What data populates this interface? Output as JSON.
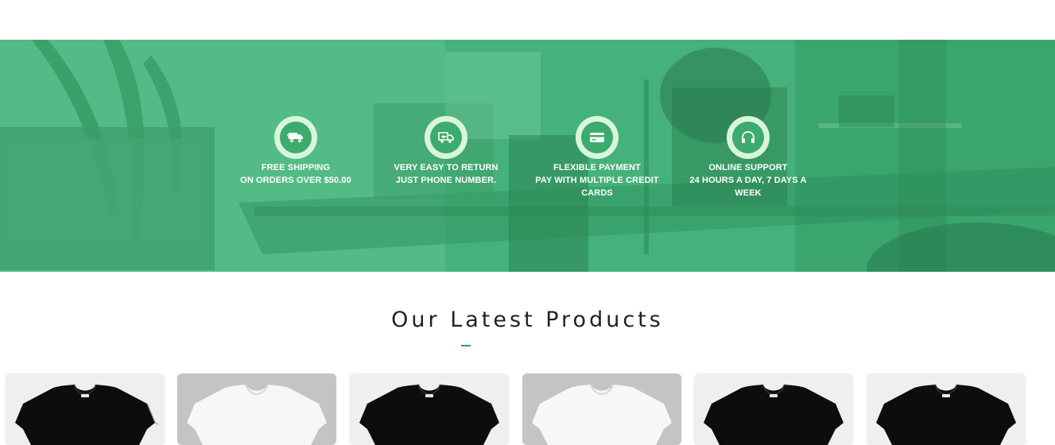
{
  "banner": {
    "overlay_color": "#3faa72",
    "features": [
      {
        "icon": "truck-icon",
        "title": "FREE SHIPPING",
        "subtitle": "ON ORDERS OVER $50.00"
      },
      {
        "icon": "return-truck-icon",
        "title": "VERY EASY TO RETURN",
        "subtitle": "JUST PHONE NUMBER."
      },
      {
        "icon": "credit-card-icon",
        "title": "FLEXIBLE PAYMENT",
        "subtitle": "PAY WITH MULTIPLE CREDIT CARDS"
      },
      {
        "icon": "headphones-icon",
        "title": "ONLINE SUPPORT",
        "subtitle": "24 HOURS A DAY, 7 DAYS A WEEK"
      }
    ]
  },
  "products_section": {
    "title": "Our Latest Products",
    "accent_color": "#2f9e5f",
    "products": [
      {
        "shirt_color": "black",
        "card_bg": "light"
      },
      {
        "shirt_color": "white",
        "card_bg": "grey"
      },
      {
        "shirt_color": "black",
        "card_bg": "light"
      },
      {
        "shirt_color": "white",
        "card_bg": "grey"
      },
      {
        "shirt_color": "black",
        "card_bg": "light"
      },
      {
        "shirt_color": "black",
        "card_bg": "light"
      }
    ]
  }
}
